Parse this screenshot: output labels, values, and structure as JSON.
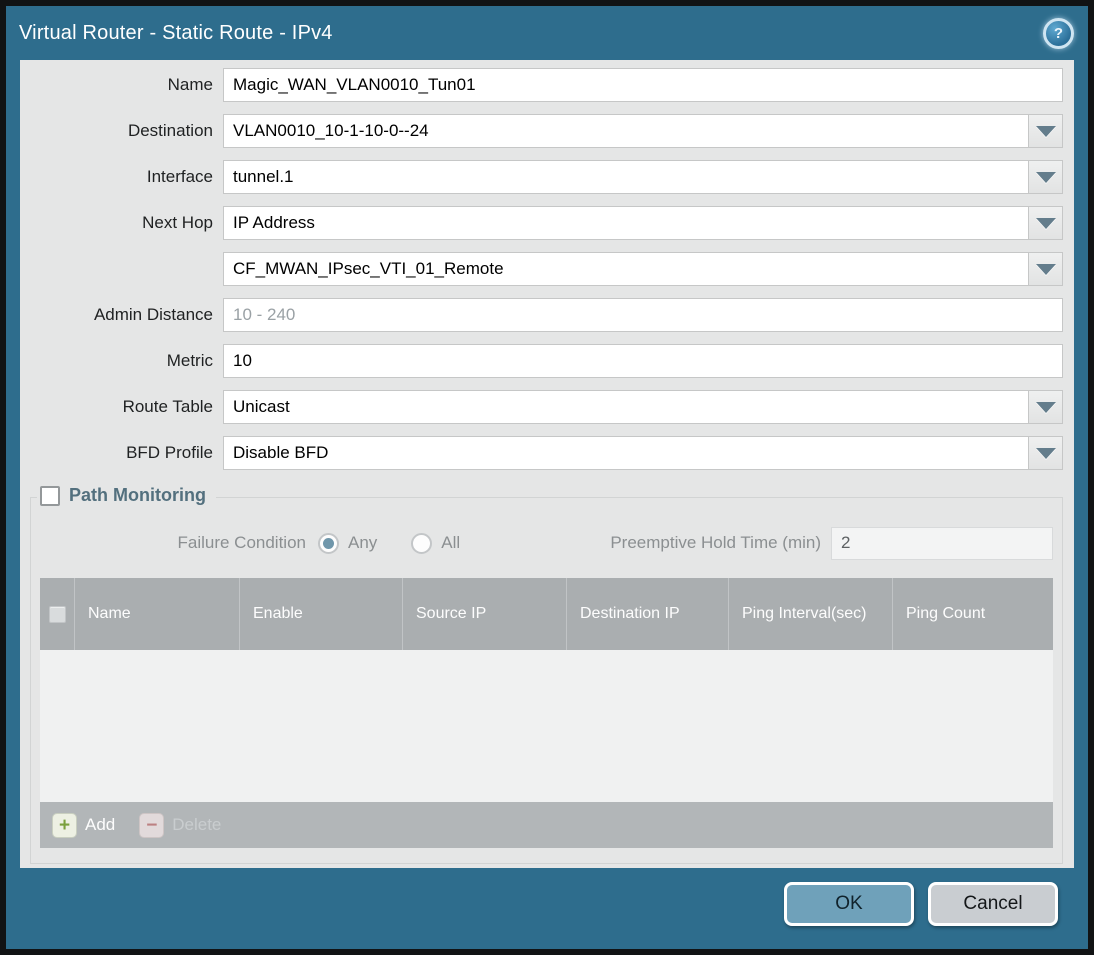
{
  "title_bar": {
    "title": "Virtual Router - Static Route - IPv4",
    "help_icon": "help-icon"
  },
  "form": {
    "fields": [
      {
        "label": "Name",
        "value": "Magic_WAN_VLAN0010_Tun01",
        "has_dropdown": false
      },
      {
        "label": "Destination",
        "value": "VLAN0010_10-1-10-0--24",
        "has_dropdown": true
      },
      {
        "label": "Interface",
        "value": "tunnel.1",
        "has_dropdown": true
      },
      {
        "label": "Next Hop",
        "value": "IP Address",
        "has_dropdown": true
      },
      {
        "label": "",
        "value": "CF_MWAN_IPsec_VTI_01_Remote",
        "has_dropdown": true
      },
      {
        "label": "Admin Distance",
        "value": "",
        "placeholder": "10 - 240",
        "has_dropdown": false
      },
      {
        "label": "Metric",
        "value": "10",
        "has_dropdown": false
      },
      {
        "label": "Route Table",
        "value": "Unicast",
        "has_dropdown": true
      },
      {
        "label": "BFD Profile",
        "value": "Disable BFD",
        "has_dropdown": true
      }
    ]
  },
  "path_monitoring": {
    "title": "Path Monitoring",
    "enabled": false,
    "failure_condition": {
      "label": "Failure Condition",
      "options": [
        {
          "label": "Any",
          "selected": true
        },
        {
          "label": "All",
          "selected": false
        }
      ]
    },
    "preemptive_hold_time": {
      "label": "Preemptive Hold Time (min)",
      "value": "2"
    },
    "table": {
      "columns": [
        "Name",
        "Enable",
        "Source IP",
        "Destination IP",
        "Ping Interval(sec)",
        "Ping Count"
      ],
      "rows": [],
      "toolbar": {
        "add_label": "Add",
        "delete_label": "Delete"
      }
    }
  },
  "footer": {
    "ok_label": "OK",
    "cancel_label": "Cancel"
  },
  "colors": {
    "titlebar": "#2e6d8d",
    "content_bg": "#e5e6e6",
    "table_header": "#aaaeb0",
    "ok_button": "#6fa1ba",
    "add_green": "#7aa03e",
    "delete_red": "#c07070",
    "radio_selected": "#6f96aa"
  }
}
